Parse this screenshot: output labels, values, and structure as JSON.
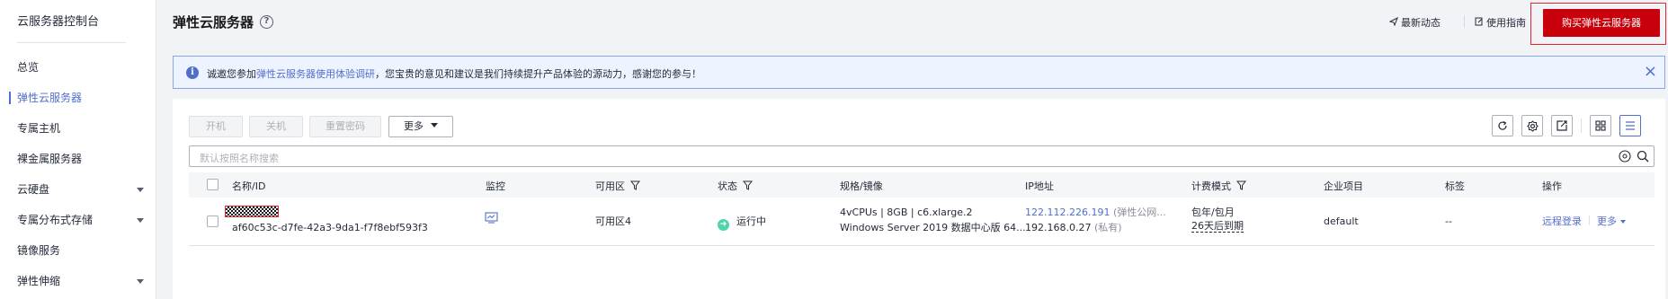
{
  "sidebar": {
    "title": "云服务器控制台",
    "items": [
      {
        "label": "总览"
      },
      {
        "label": "弹性云服务器"
      },
      {
        "label": "专属主机"
      },
      {
        "label": "裸金属服务器"
      },
      {
        "label": "云硬盘"
      },
      {
        "label": "专属分布式存储"
      },
      {
        "label": "镜像服务"
      },
      {
        "label": "弹性伸缩"
      }
    ]
  },
  "header": {
    "title": "弹性云服务器",
    "help": "?",
    "latest_news": "最新动态",
    "user_guide": "使用指南",
    "buy_button": "购买弹性云服务器"
  },
  "notice": {
    "prefix": "诚邀您参加",
    "link": "弹性云服务器使用体验调研",
    "suffix": "，您宝贵的意见和建议是我们持续提升产品体验的源动力，感谢您的参与！",
    "close": "×"
  },
  "toolbar": {
    "start": "开机",
    "stop": "关机",
    "reset_password": "重置密码",
    "more": "更多"
  },
  "search": {
    "placeholder": "默认按照名称搜索"
  },
  "table": {
    "columns": {
      "name_id": "名称/ID",
      "monitor": "监控",
      "az": "可用区",
      "status": "状态",
      "spec_image": "规格/镜像",
      "ip": "IP地址",
      "billing": "计费模式",
      "enterprise_project": "企业项目",
      "tags": "标签",
      "operations": "操作"
    },
    "rows": [
      {
        "id": "af60c53c-d7fe-42a3-9da1-f7f8ebf593f3",
        "az": "可用区4",
        "status": "运行中",
        "spec": "4vCPUs | 8GB | c6.xlarge.2",
        "image": "Windows Server 2019 数据中心版 64...",
        "public_ip": "122.112.226.191",
        "public_ip_note": "(弹性公网...",
        "private_ip": "192.168.0.27",
        "private_ip_note": "(私有)",
        "billing_mode": "包年/包月",
        "expiry": "26天后到期",
        "enterprise_project": "default",
        "tags": "--",
        "remote_login": "远程登录",
        "more": "更多"
      }
    ]
  },
  "colors": {
    "accent": "#526ecc",
    "buy_button": "#c7000b",
    "running": "#50d4ab",
    "highlight_outline": "#e0282e"
  }
}
